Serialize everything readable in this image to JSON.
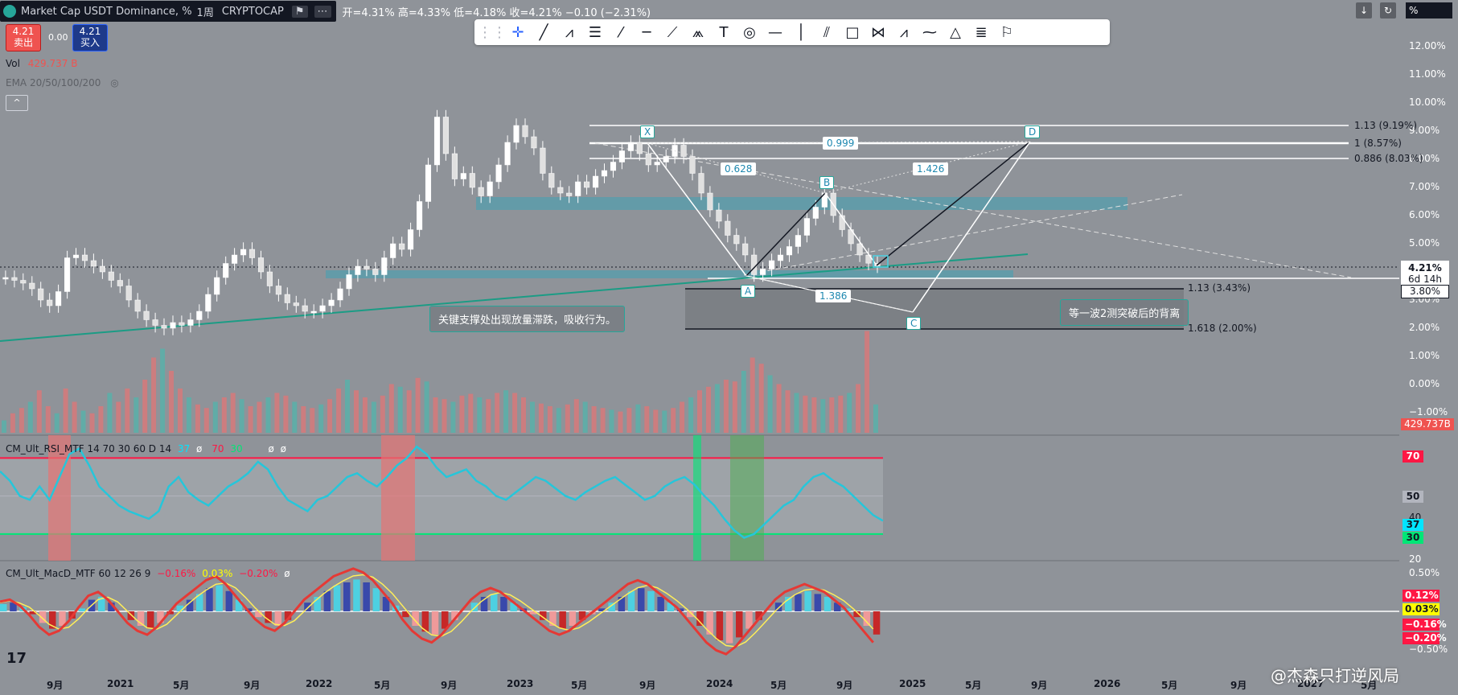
{
  "header": {
    "symbol": "Market Cap USDT Dominance, %",
    "interval": "1周",
    "exchange": "CRYPTOCAP",
    "ohlc": "开=4.31% 高=4.33% 低=4.18% 收=4.21% −0.10 (−2.31%)",
    "sell_price": "4.21",
    "sell_label": "卖出",
    "spread": "0.00",
    "buy_price": "4.21",
    "buy_label": "买入"
  },
  "legend": {
    "vol": "Vol",
    "vol_value": "429.737 B",
    "ema": "EMA 20/50/100/200",
    "rsi": "CM_Ult_RSI_MTF 14 70 30 60 D 14",
    "rsi_vals": [
      "37",
      "ø",
      "70",
      "30",
      "ø",
      "ø"
    ],
    "macd": "CM_Ult_MacD_MTF 60 12 26 9",
    "macd_vals": [
      "−0.16%",
      "0.03%",
      "−0.20%",
      "ø"
    ]
  },
  "toolbar": {
    "icons": [
      "drag-icon",
      "crosshair-icon",
      "trend-line-icon",
      "pitchfork-icon",
      "fib-icon",
      "brush-icon",
      "horizontal-ray-icon",
      "ray-icon",
      "xabcd-icon",
      "text-icon",
      "circle-icon",
      "horizontal-line-icon",
      "vertical-line-icon",
      "channel-icon",
      "rectangle-icon",
      "pattern-icon",
      "abc-icon",
      "path-icon",
      "triangle-icon",
      "fib-extension-icon",
      "flag-icon"
    ]
  },
  "right_top": {
    "percent": "%"
  },
  "chart_data": {
    "type": "candlestick",
    "title": "Market Cap USDT Dominance, %",
    "y_ticks": [
      "12.00%",
      "11.00%",
      "10.00%",
      "9.00%",
      "8.00%",
      "7.00%",
      "6.00%",
      "5.00%",
      "4.00%",
      "3.00%",
      "2.00%",
      "1.00%",
      "0.00%",
      "−1.00%"
    ],
    "ylim": [
      -1.2,
      12.5
    ],
    "x_ticks": [
      "9月",
      "2021",
      "5月",
      "9月",
      "2022",
      "5月",
      "9月",
      "2023",
      "5月",
      "9月",
      "2024",
      "5月",
      "9月",
      "2025",
      "5月",
      "9月",
      "2026",
      "5月",
      "9月",
      "2027",
      "5月"
    ],
    "last_price": "4.21%",
    "countdown": "6d 14h",
    "level_tag": "3.80%",
    "volume_tag": "429.737B",
    "fib_levels": [
      {
        "label": "1.13 (9.19%)",
        "value": 9.19
      },
      {
        "label": "1 (8.57%)",
        "value": 8.57
      },
      {
        "label": "0.886 (8.03%)",
        "value": 8.03
      },
      {
        "label": "1.13 (3.43%)",
        "value": 3.43
      },
      {
        "label": "1.618 (2.00%)",
        "value": 2.0
      }
    ],
    "harmonic_points": {
      "X": "X",
      "A": "A",
      "B": "B",
      "C": "C",
      "D": "D"
    },
    "harmonic_ratios": [
      "0.999",
      "0.628",
      "1.426",
      "1.386"
    ],
    "annotations": [
      "关键支撑处出现放量滞跌，吸收行为。",
      "等一波2测突破后的背离"
    ],
    "rsi_ticks": [
      "70",
      "50",
      "40",
      "37",
      "30",
      "20"
    ],
    "macd_ticks": [
      "0.50%",
      "0.12%",
      "0.03%",
      "−0.16%",
      "−0.20%",
      "−0.50%"
    ],
    "price_series": [
      3.8,
      3.7,
      3.6,
      3.4,
      3.0,
      2.8,
      3.3,
      4.5,
      4.6,
      4.4,
      4.2,
      4.0,
      3.7,
      3.5,
      3.0,
      2.6,
      2.3,
      2.1,
      2.0,
      2.2,
      2.1,
      2.3,
      2.6,
      3.2,
      3.8,
      4.3,
      4.6,
      4.8,
      4.5,
      4.0,
      3.5,
      3.2,
      2.9,
      2.8,
      2.6,
      2.6,
      2.8,
      3.0,
      3.4,
      3.9,
      4.2,
      4.1,
      3.9,
      4.5,
      5.0,
      4.8,
      5.5,
      6.5,
      7.8,
      9.5,
      8.2,
      7.3,
      7.5,
      7.0,
      6.7,
      7.2,
      7.8,
      8.6,
      9.2,
      8.8,
      8.4,
      7.5,
      7.0,
      6.8,
      6.7,
      7.2,
      7.0,
      7.4,
      7.6,
      7.9,
      8.3,
      8.6,
      8.2,
      7.8,
      7.9,
      8.1,
      8.5,
      8.1,
      7.5,
      6.8,
      6.2,
      5.8,
      5.3,
      5.0,
      4.6,
      3.9,
      4.1,
      4.4,
      4.6,
      4.9,
      5.3,
      5.9,
      6.3,
      6.8,
      6.0,
      5.5,
      5.0,
      4.6,
      4.31,
      4.21
    ],
    "volume_series": [
      14,
      22,
      28,
      35,
      48,
      30,
      22,
      50,
      35,
      25,
      22,
      30,
      45,
      35,
      50,
      40,
      60,
      85,
      95,
      70,
      50,
      40,
      32,
      28,
      35,
      40,
      45,
      38,
      30,
      35,
      40,
      45,
      42,
      35,
      30,
      28,
      32,
      38,
      50,
      60,
      48,
      40,
      35,
      42,
      55,
      52,
      48,
      62,
      58,
      40,
      38,
      35,
      42,
      44,
      40,
      38,
      45,
      48,
      45,
      40,
      35,
      33,
      30,
      28,
      32,
      38,
      35,
      30,
      28,
      26,
      24,
      28,
      32,
      30,
      26,
      25,
      28,
      35,
      40,
      48,
      52,
      55,
      60,
      58,
      70,
      85,
      78,
      65,
      55,
      48,
      45,
      42,
      40,
      38,
      40,
      42,
      45,
      55,
      115,
      32
    ],
    "rsi_series": [
      63,
      58,
      50,
      48,
      55,
      48,
      60,
      72,
      75,
      66,
      55,
      50,
      45,
      42,
      40,
      38,
      42,
      55,
      60,
      52,
      48,
      45,
      50,
      55,
      58,
      62,
      68,
      64,
      55,
      48,
      45,
      42,
      48,
      50,
      55,
      60,
      62,
      58,
      55,
      60,
      66,
      70,
      76,
      72,
      65,
      60,
      62,
      64,
      58,
      55,
      50,
      48,
      52,
      56,
      60,
      58,
      54,
      50,
      48,
      52,
      55,
      58,
      60,
      56,
      52,
      48,
      50,
      55,
      58,
      60,
      56,
      50,
      45,
      38,
      32,
      28,
      30,
      35,
      40,
      45,
      48,
      55,
      60,
      62,
      58,
      55,
      50,
      45,
      40,
      37
    ],
    "macd_series": [
      0.05,
      0.06,
      0.03,
      -0.02,
      -0.08,
      -0.12,
      -0.1,
      -0.05,
      0.02,
      0.08,
      0.1,
      0.06,
      0.0,
      -0.06,
      -0.1,
      -0.12,
      -0.08,
      -0.02,
      0.04,
      0.08,
      0.12,
      0.16,
      0.18,
      0.14,
      0.08,
      0.02,
      -0.04,
      -0.08,
      -0.1,
      -0.06,
      0.0,
      0.06,
      0.1,
      0.14,
      0.18,
      0.2,
      0.22,
      0.2,
      0.16,
      0.1,
      0.04,
      -0.04,
      -0.1,
      -0.14,
      -0.16,
      -0.12,
      -0.06,
      0.0,
      0.06,
      0.1,
      0.12,
      0.1,
      0.06,
      0.02,
      -0.02,
      -0.06,
      -0.1,
      -0.12,
      -0.1,
      -0.06,
      -0.02,
      0.02,
      0.06,
      0.1,
      0.14,
      0.16,
      0.14,
      0.1,
      0.06,
      0.02,
      -0.04,
      -0.1,
      -0.16,
      -0.2,
      -0.22,
      -0.18,
      -0.12,
      -0.06,
      0.0,
      0.06,
      0.1,
      0.12,
      0.14,
      0.12,
      0.1,
      0.06,
      0.02,
      -0.04,
      -0.1,
      -0.16
    ]
  },
  "watermark": "@杰森只打逆风局",
  "brand": "17"
}
